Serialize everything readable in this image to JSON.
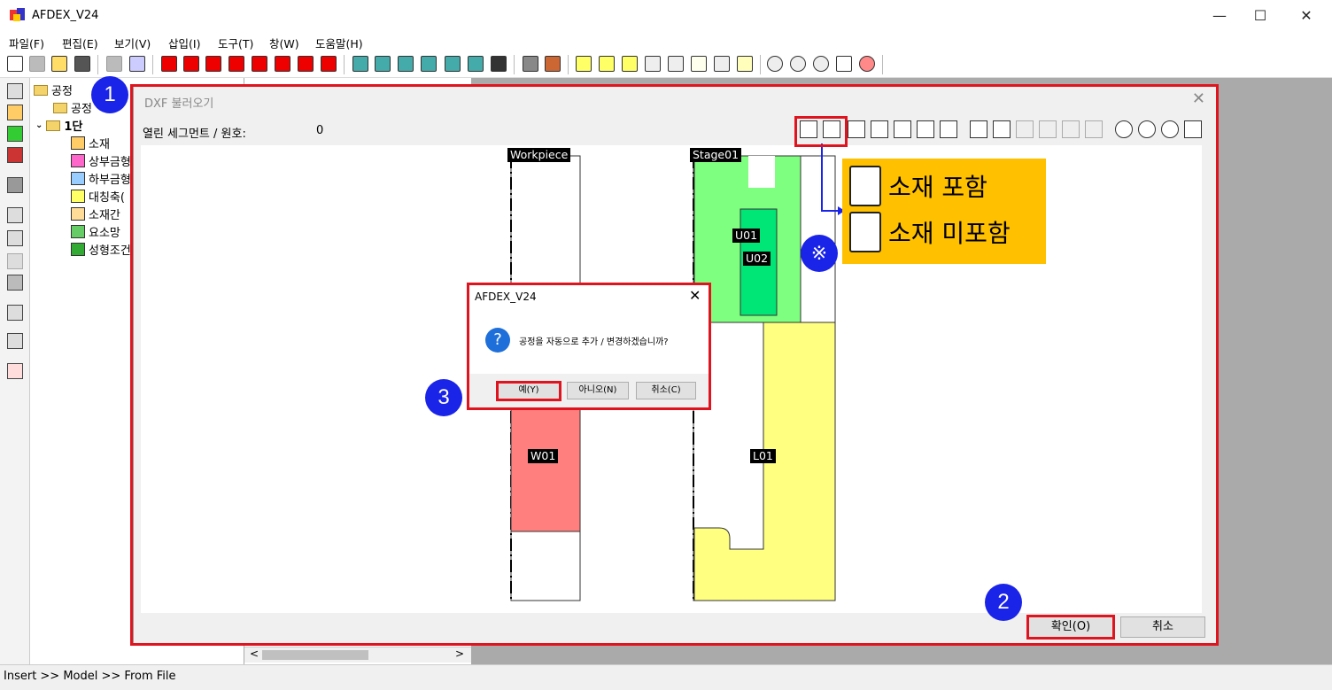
{
  "app": {
    "title": "AFDEX_V24"
  },
  "window_controls": {
    "minimize": "—",
    "maximize": "☐",
    "close": "✕"
  },
  "menu": [
    "파일(F)",
    "편집(E)",
    "보기(V)",
    "삽입(I)",
    "도구(T)",
    "창(W)",
    "도움말(H)"
  ],
  "tree": {
    "root": "공정",
    "child": "공정",
    "stage": "1단",
    "items": [
      "소재",
      "상부금형",
      "하부금형",
      "대칭축(",
      "소재간",
      "요소망",
      "성형조건"
    ]
  },
  "status": {
    "text": "Insert >> Model >> From File"
  },
  "dxf_dialog": {
    "title": "DXF 불러오기",
    "open_segment_label": "열린 세그먼트 / 원호:",
    "open_segment_value": "0",
    "ok": "확인(O)",
    "cancel": "취소",
    "labels": {
      "workpiece": "Workpiece",
      "stage": "Stage01",
      "u01": "U01",
      "u02": "U02",
      "w01": "W01",
      "l01": "L01"
    }
  },
  "callout": {
    "include": "소재 포함",
    "exclude": "소재 미포함",
    "note_symbol": "※"
  },
  "badges": {
    "one": "1",
    "two": "2",
    "three": "3"
  },
  "msgbox": {
    "title": "AFDEX_V24",
    "icon": "?",
    "text": "공정을 자동으로 추가 / 변경하겠습니까?",
    "yes": "예(Y)",
    "no": "아니오(N)",
    "cancel": "취소(C)"
  },
  "colors": {
    "highlight": "#e0141e",
    "badge": "#1a23e8",
    "callout": "#ffc000",
    "workpiece": "#ff7f7f",
    "upper": "#7fff7f",
    "lower": "#ffff80"
  }
}
